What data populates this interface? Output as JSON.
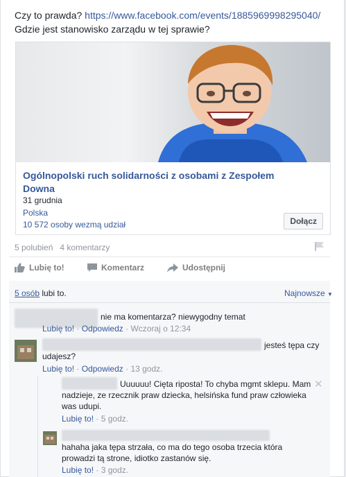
{
  "post": {
    "text_line1": "Czy to prawda? ",
    "link_url": "https://www.facebook.com/events/1885969998295040/",
    "text_line2": "Gdzie jest stanowisko zarządu w tej sprawie?"
  },
  "event": {
    "title": "Ogólnopolski ruch solidarności z osobami z Zespołem Downa",
    "date": "31 grudnia",
    "place": "Polska",
    "attending": "10 572 osoby wezmą udział",
    "join_label": "Dołącz"
  },
  "stats": {
    "likes": "5 polubień",
    "comments": "4 komentarzy"
  },
  "actions": {
    "like": "Lubię to!",
    "comment": "Komentarz",
    "share": "Udostępnij"
  },
  "likes_summary": {
    "people": "5 osób",
    "suffix": " lubi to."
  },
  "sort_label": "Najnowsze",
  "comments": [
    {
      "text": "nie ma komentarza? niewygodny temat",
      "like": "Lubię to!",
      "reply": "Odpowiedz",
      "time": "Wczoraj o 12:34"
    },
    {
      "text_a": "jesteś tępa czy",
      "text_b": "udajesz?",
      "like": "Lubię to!",
      "reply": "Odpowiedz",
      "time": "13 godz."
    },
    {
      "text_a": "Uuuuuu! Cięta riposta! To chyba mgmt sklepu. Mam",
      "text_b": "nadzieje, ze rzecznik praw dziecka, helsińska fund praw człowieka",
      "text_c": "was udupi.",
      "like": "Lubię to!",
      "time": "5 godz."
    },
    {
      "text_a": "hahaha jaka tępa strzała, co ma do tego osoba trzecia która",
      "text_b": "prowadzi tą strone, idiotko zastanów się.",
      "like": "Lubię to!",
      "time": "3 godz."
    }
  ],
  "colors": {
    "link": "#365899",
    "meta": "#90949c",
    "text": "#1d2129"
  }
}
